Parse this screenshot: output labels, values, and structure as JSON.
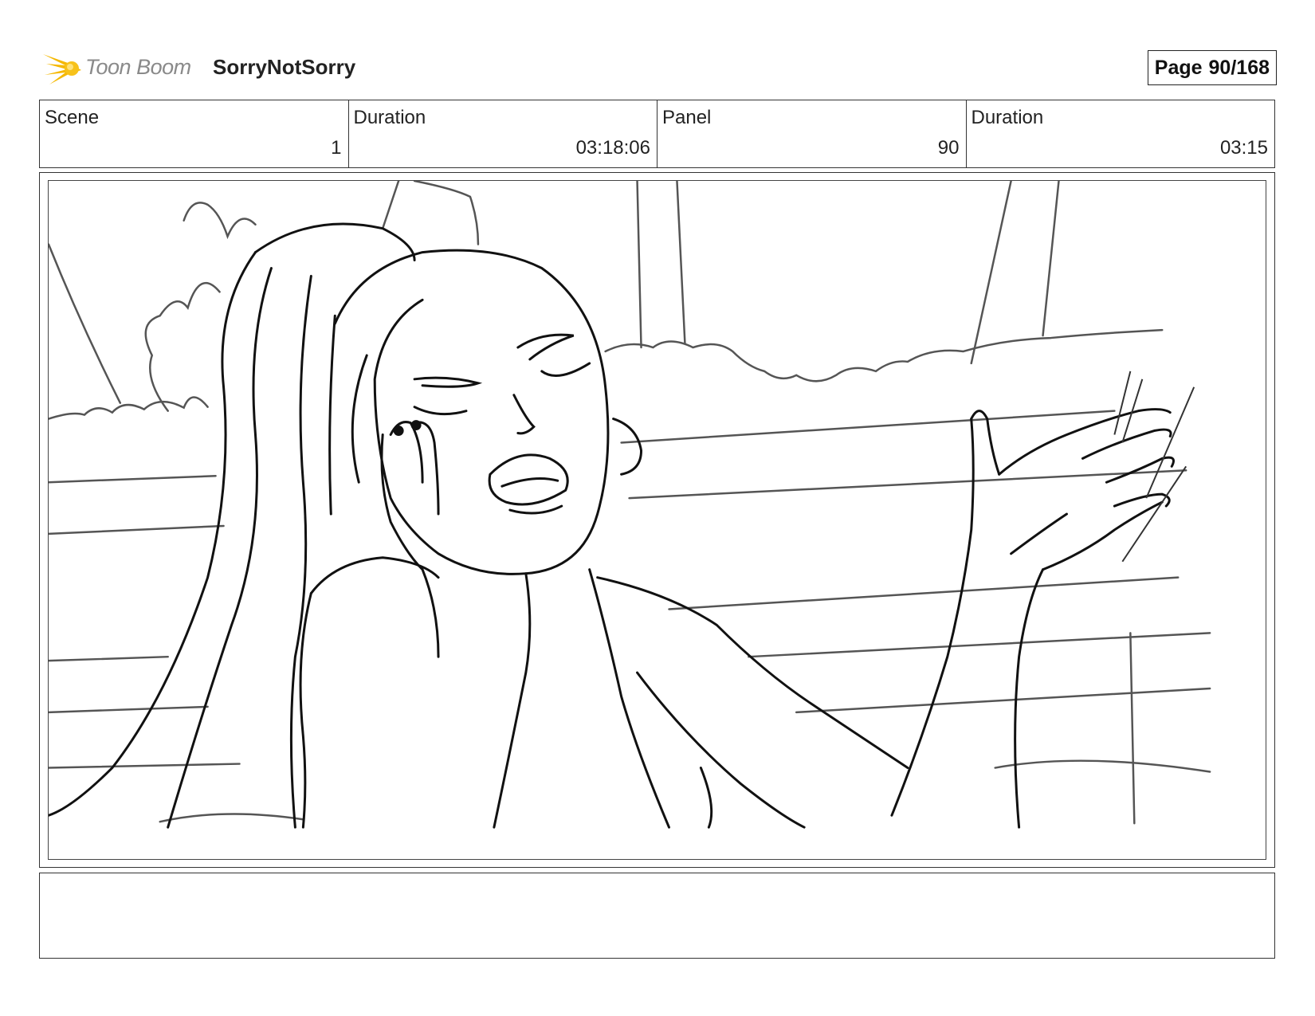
{
  "header": {
    "logo_text": "Toon Boom",
    "project_title": "SorryNotSorry",
    "page_label": "Page",
    "page_value": "90/168"
  },
  "info": {
    "scene_label": "Scene",
    "scene_value": "1",
    "scene_duration_label": "Duration",
    "scene_duration_value": "03:18:06",
    "panel_label": "Panel",
    "panel_value": "90",
    "panel_duration_label": "Duration",
    "panel_duration_value": "03:15"
  },
  "notes": {
    "text": ""
  },
  "colors": {
    "logo_accent": "#f5b800",
    "border": "#333333"
  },
  "icons": {
    "logo": "toon-boom-star-icon"
  }
}
